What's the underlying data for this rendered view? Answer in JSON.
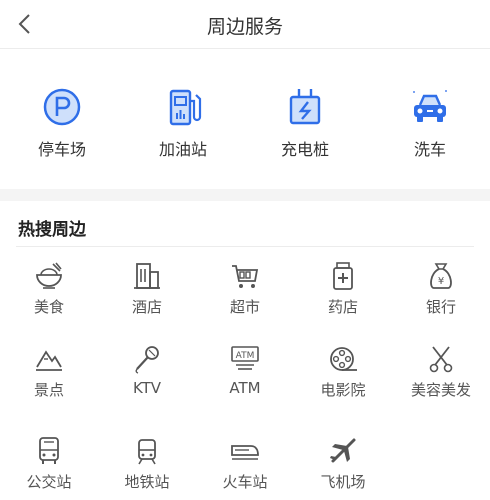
{
  "header": {
    "title": "周边服务"
  },
  "services": [
    {
      "label": "停车场",
      "icon": "parking-icon"
    },
    {
      "label": "加油站",
      "icon": "gas-station-icon"
    },
    {
      "label": "充电桩",
      "icon": "charging-pile-icon"
    },
    {
      "label": "洗车",
      "icon": "car-wash-icon"
    }
  ],
  "hot": {
    "title": "热搜周边",
    "items": [
      {
        "label": "美食",
        "icon": "food-icon"
      },
      {
        "label": "酒店",
        "icon": "hotel-icon"
      },
      {
        "label": "超市",
        "icon": "supermarket-icon"
      },
      {
        "label": "药店",
        "icon": "pharmacy-icon"
      },
      {
        "label": "银行",
        "icon": "bank-icon"
      },
      {
        "label": "景点",
        "icon": "scenic-spot-icon"
      },
      {
        "label": "KTV",
        "icon": "ktv-icon"
      },
      {
        "label": "ATM",
        "icon": "atm-icon",
        "icon_text": "ATM"
      },
      {
        "label": "电影院",
        "icon": "cinema-icon"
      },
      {
        "label": "美容美发",
        "icon": "beauty-salon-icon"
      },
      {
        "label": "公交站",
        "icon": "bus-stop-icon"
      },
      {
        "label": "地铁站",
        "icon": "subway-station-icon"
      },
      {
        "label": "火车站",
        "icon": "train-station-icon"
      },
      {
        "label": "飞机场",
        "icon": "airport-icon"
      }
    ]
  },
  "colors": {
    "accent": "#2f6ee8",
    "accent_light": "#cfe0fb",
    "icon_gray": "#555555"
  }
}
